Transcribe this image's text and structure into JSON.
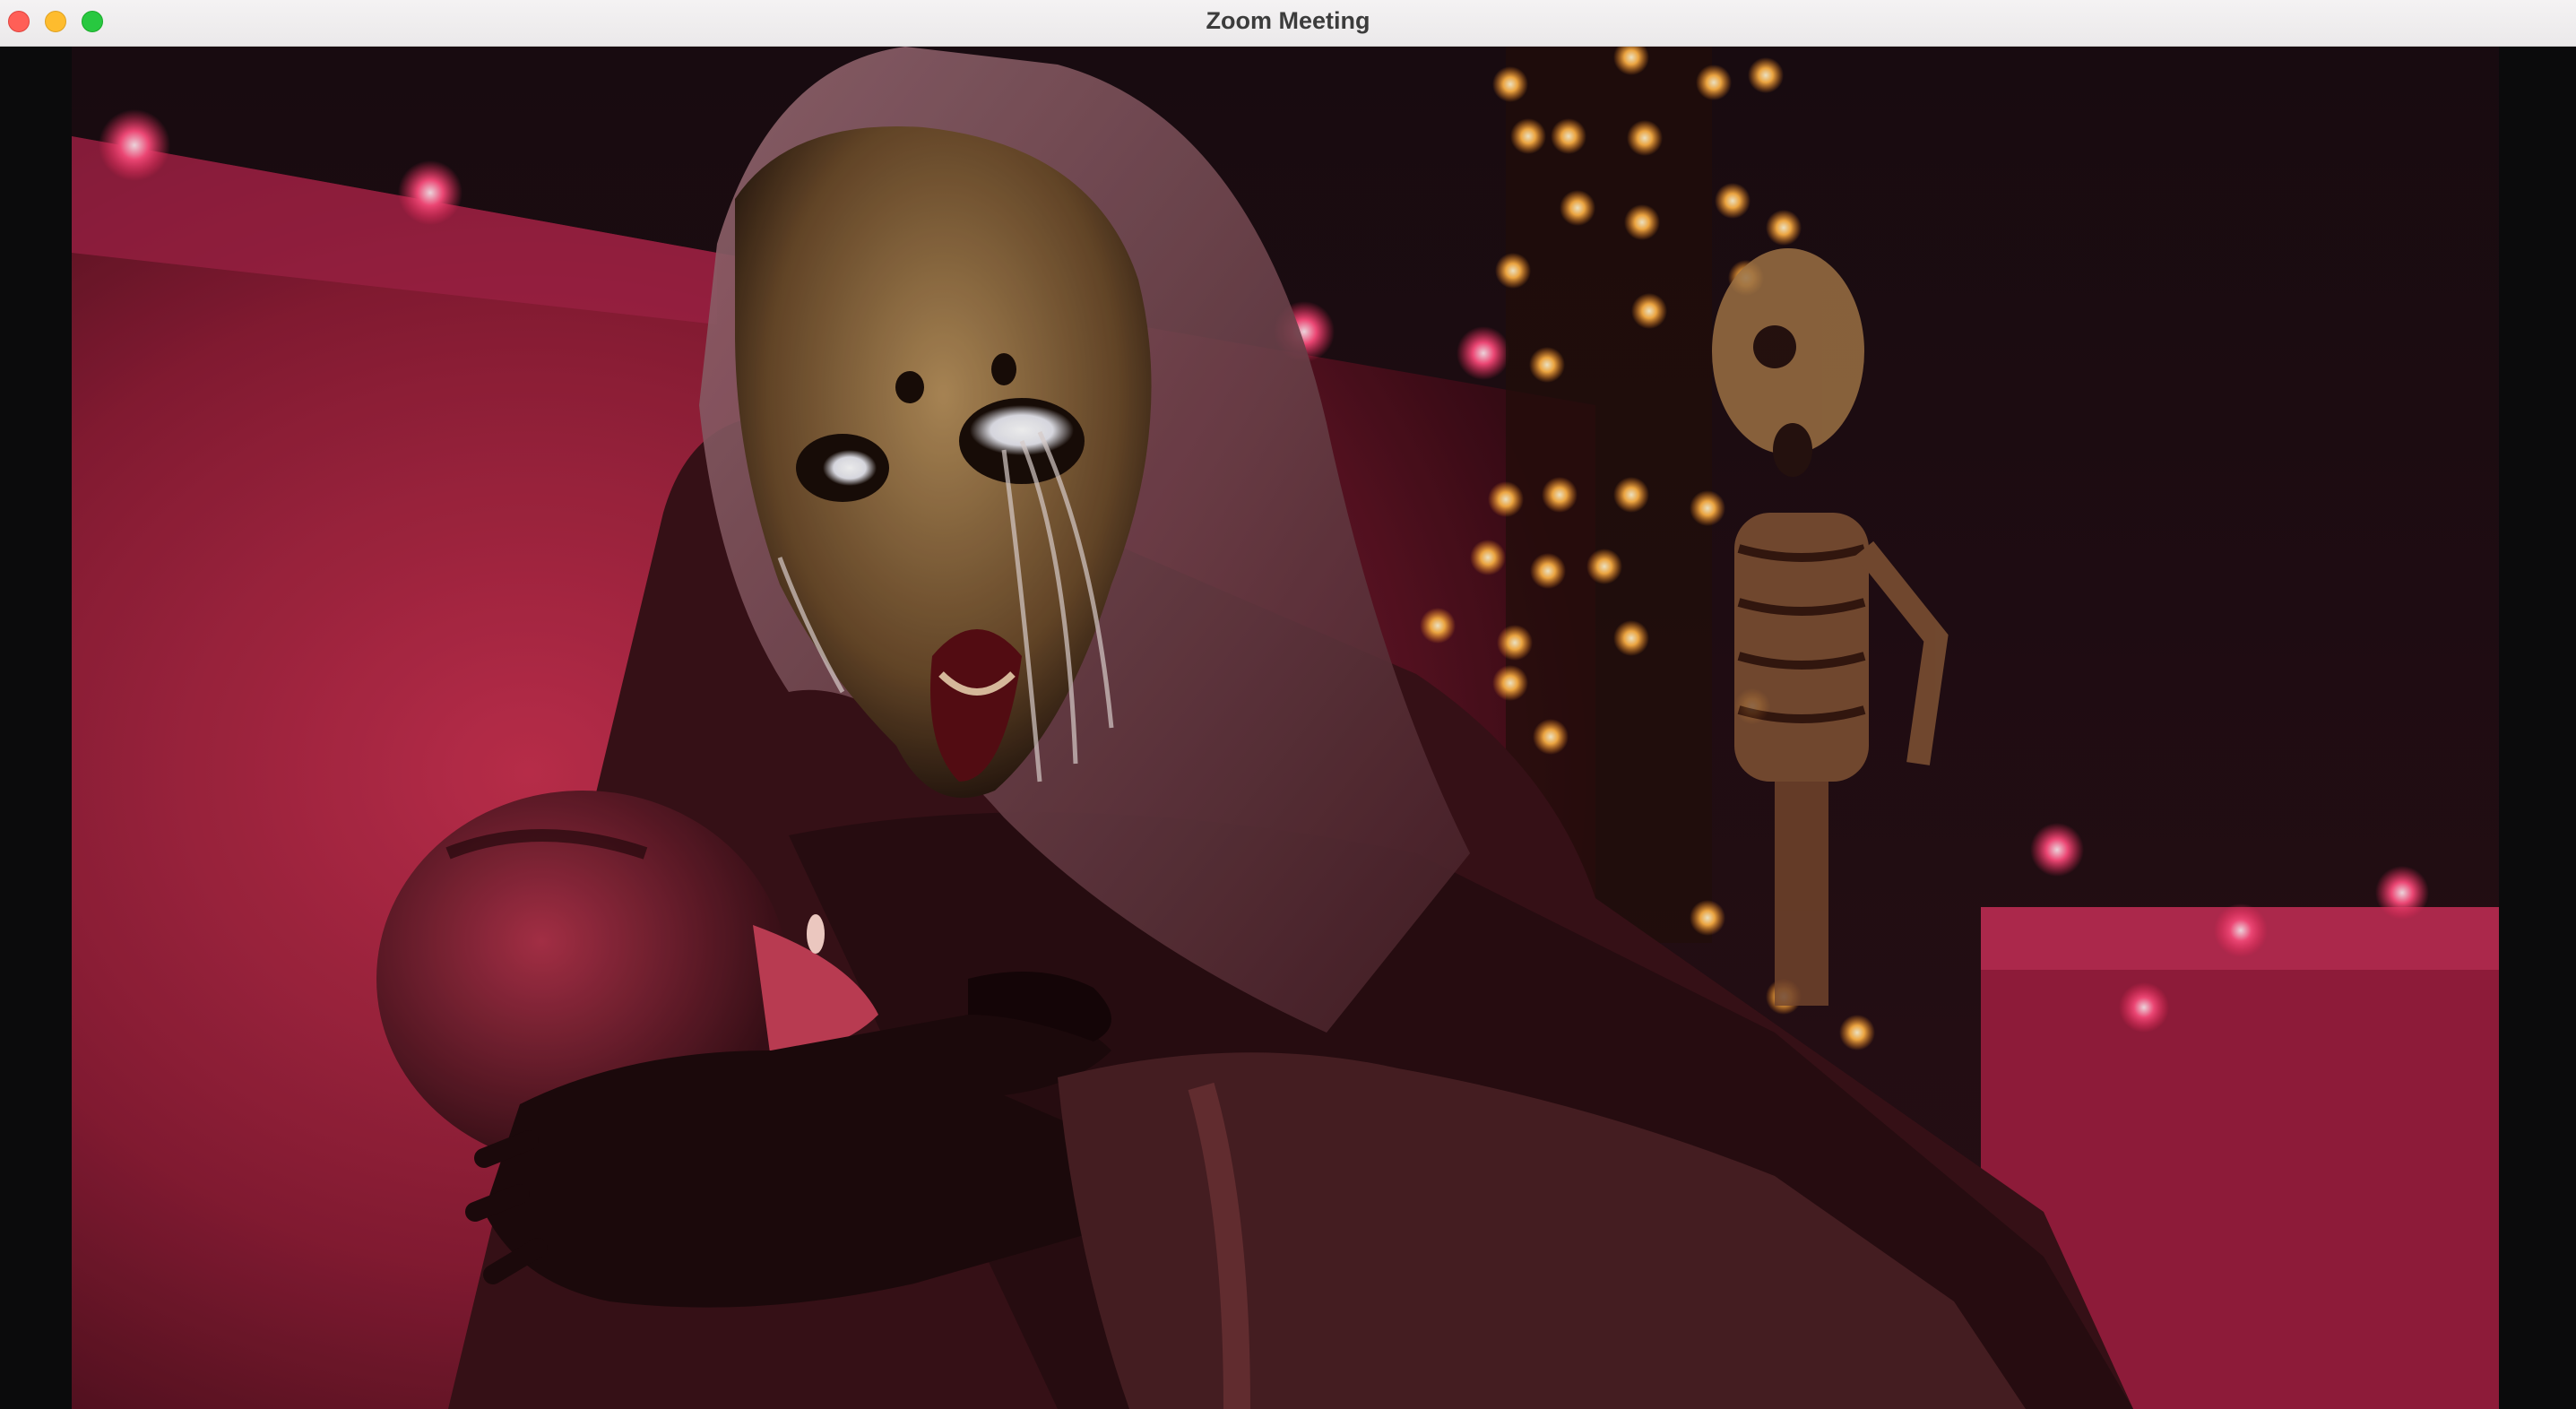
{
  "window": {
    "title": "Zoom Meeting",
    "controls": {
      "close": "close-button",
      "minimize": "minimize-button",
      "zoom": "zoom-button"
    }
  },
  "video": {
    "content": "participant-video-feed"
  },
  "colors": {
    "titlebar": "#f0eeef",
    "close": "#ff5f57",
    "minimize": "#febc2e",
    "zoom": "#28c840",
    "letterbox": "#0b0b0c"
  }
}
